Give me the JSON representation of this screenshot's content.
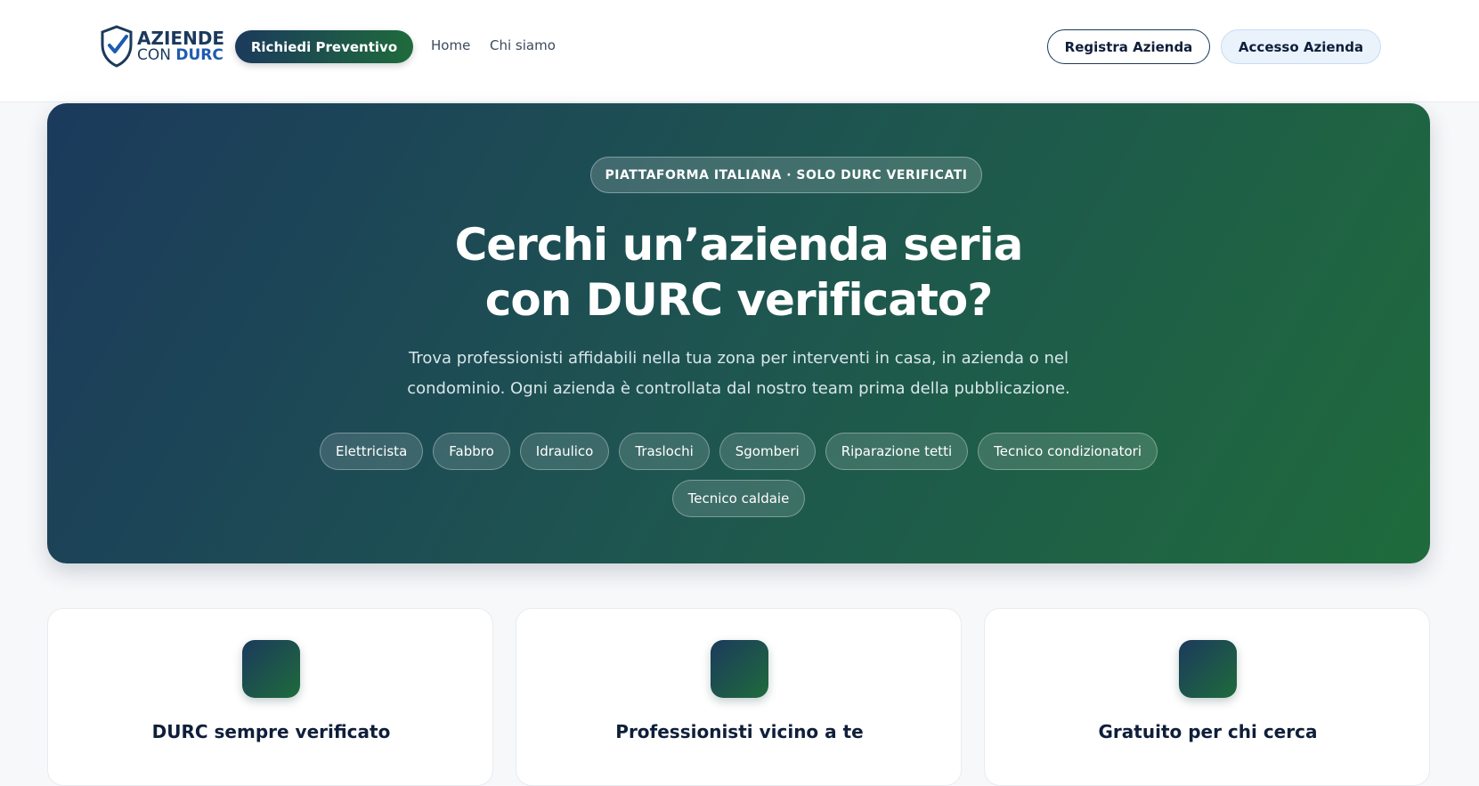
{
  "header": {
    "logo": {
      "line1": "AZIENDE",
      "line2_prefix": "CON",
      "line2_brand": "DURC"
    },
    "cta_label": "Richiedi Preventivo",
    "nav": [
      {
        "label": "Home"
      },
      {
        "label": "Chi siamo"
      }
    ],
    "register_label": "Registra Azienda",
    "login_label": "Accesso Azienda"
  },
  "hero": {
    "badge": "PIATTAFORMA ITALIANA · SOLO DURC VERIFICATI",
    "title_line1": "Cerchi un’azienda seria",
    "title_line2": "con DURC verificato?",
    "subtitle": "Trova professionisti affidabili nella tua zona per interventi in casa, in azienda o nel condominio. Ogni azienda è controllata dal nostro team prima della pubblicazione.",
    "categories": [
      "Elettricista",
      "Fabbro",
      "Idraulico",
      "Traslochi",
      "Sgomberi",
      "Riparazione tetti",
      "Tecnico condizionatori",
      "Tecnico caldaie"
    ]
  },
  "features": [
    {
      "title": "DURC sempre verificato"
    },
    {
      "title": "Professionisti vicino a te"
    },
    {
      "title": "Gratuito per chi cerca"
    }
  ],
  "colors": {
    "brand_navy": "#1b3a5c",
    "brand_green": "#1f6b3c",
    "brand_blue": "#1e5bb0"
  }
}
